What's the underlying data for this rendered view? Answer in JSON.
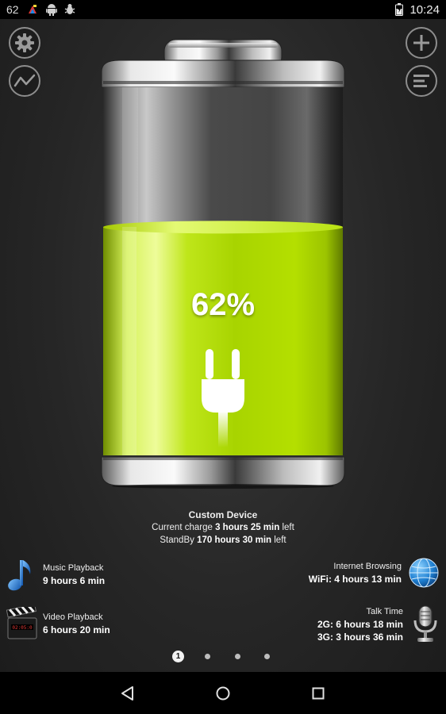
{
  "status_bar": {
    "left_text": "62",
    "time": "10:24",
    "icons": [
      "app-notification-icon",
      "android-icon",
      "bug-icon",
      "battery-status-icon"
    ]
  },
  "toolbar": {
    "left": [
      "gear-icon",
      "trend-icon"
    ],
    "right": [
      "add-icon",
      "menu-lines-icon"
    ]
  },
  "battery": {
    "percent_label": "62%",
    "level_percent": 62,
    "charging": true,
    "fill_color": "#b6e100"
  },
  "device": {
    "name": "Custom Device",
    "current_charge_prefix": "Current charge",
    "current_charge_value": "3 hours 25 min",
    "current_charge_suffix": "left",
    "standby_prefix": "StandBy",
    "standby_value": "170 hours 30 min",
    "standby_suffix": "left"
  },
  "stats": {
    "music": {
      "label": "Music Playback",
      "value": "9 hours 6 min",
      "icon": "music-note-icon"
    },
    "video": {
      "label": "Video Playback",
      "value": "6 hours 20 min",
      "icon": "clapperboard-icon"
    },
    "internet": {
      "label": "Internet Browsing",
      "value": "WiFi: 4 hours 13 min",
      "icon": "globe-icon"
    },
    "talk": {
      "label": "Talk Time",
      "value_2g": "2G: 6 hours 18 min",
      "value_3g": "3G: 3 hours 36 min",
      "icon": "microphone-icon"
    }
  },
  "pager": {
    "active_label": "1",
    "total": 4,
    "active_index": 0
  },
  "nav": [
    "back-icon",
    "home-icon",
    "recents-icon"
  ]
}
